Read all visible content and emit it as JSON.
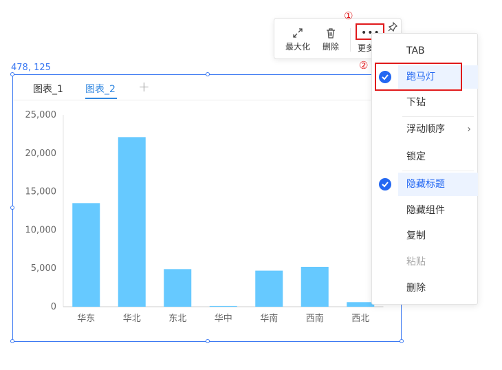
{
  "coord_label": "478, 125",
  "tabs": [
    {
      "label": "图表_1",
      "active": false
    },
    {
      "label": "图表_2",
      "active": true
    }
  ],
  "tab_add": "+",
  "toolbar": {
    "maximize_label": "最大化",
    "delete_label": "删除",
    "more_label": "更多",
    "more_dots": "•••"
  },
  "annotations": {
    "step1": "①",
    "step2": "②"
  },
  "menu": {
    "items": [
      {
        "label": "TAB"
      },
      {
        "label": "跑马灯",
        "checked": true
      },
      {
        "label": "下钻"
      },
      {
        "label": "浮动顺序",
        "submenu": true
      },
      {
        "label": "锁定"
      },
      {
        "label": "隐藏标题",
        "checked": true
      },
      {
        "label": "隐藏组件"
      },
      {
        "label": "复制"
      },
      {
        "label": "粘贴",
        "disabled": true
      },
      {
        "label": "删除"
      }
    ],
    "submenu_arrow": "›"
  },
  "colors": {
    "accent": "#2468f2",
    "bar": "#66c9ff",
    "annotation": "#e0191b"
  },
  "chart_data": {
    "type": "bar",
    "categories": [
      "华东",
      "华北",
      "东北",
      "华中",
      "华南",
      "西南",
      "西北"
    ],
    "values": [
      13500,
      22100,
      4900,
      100,
      4700,
      5200,
      600
    ],
    "ylim": [
      0,
      25000
    ],
    "yticks": [
      "0",
      "5,000",
      "10,000",
      "15,000",
      "20,000",
      "25,000"
    ],
    "grid": false,
    "title": "",
    "xlabel": "",
    "ylabel": ""
  }
}
